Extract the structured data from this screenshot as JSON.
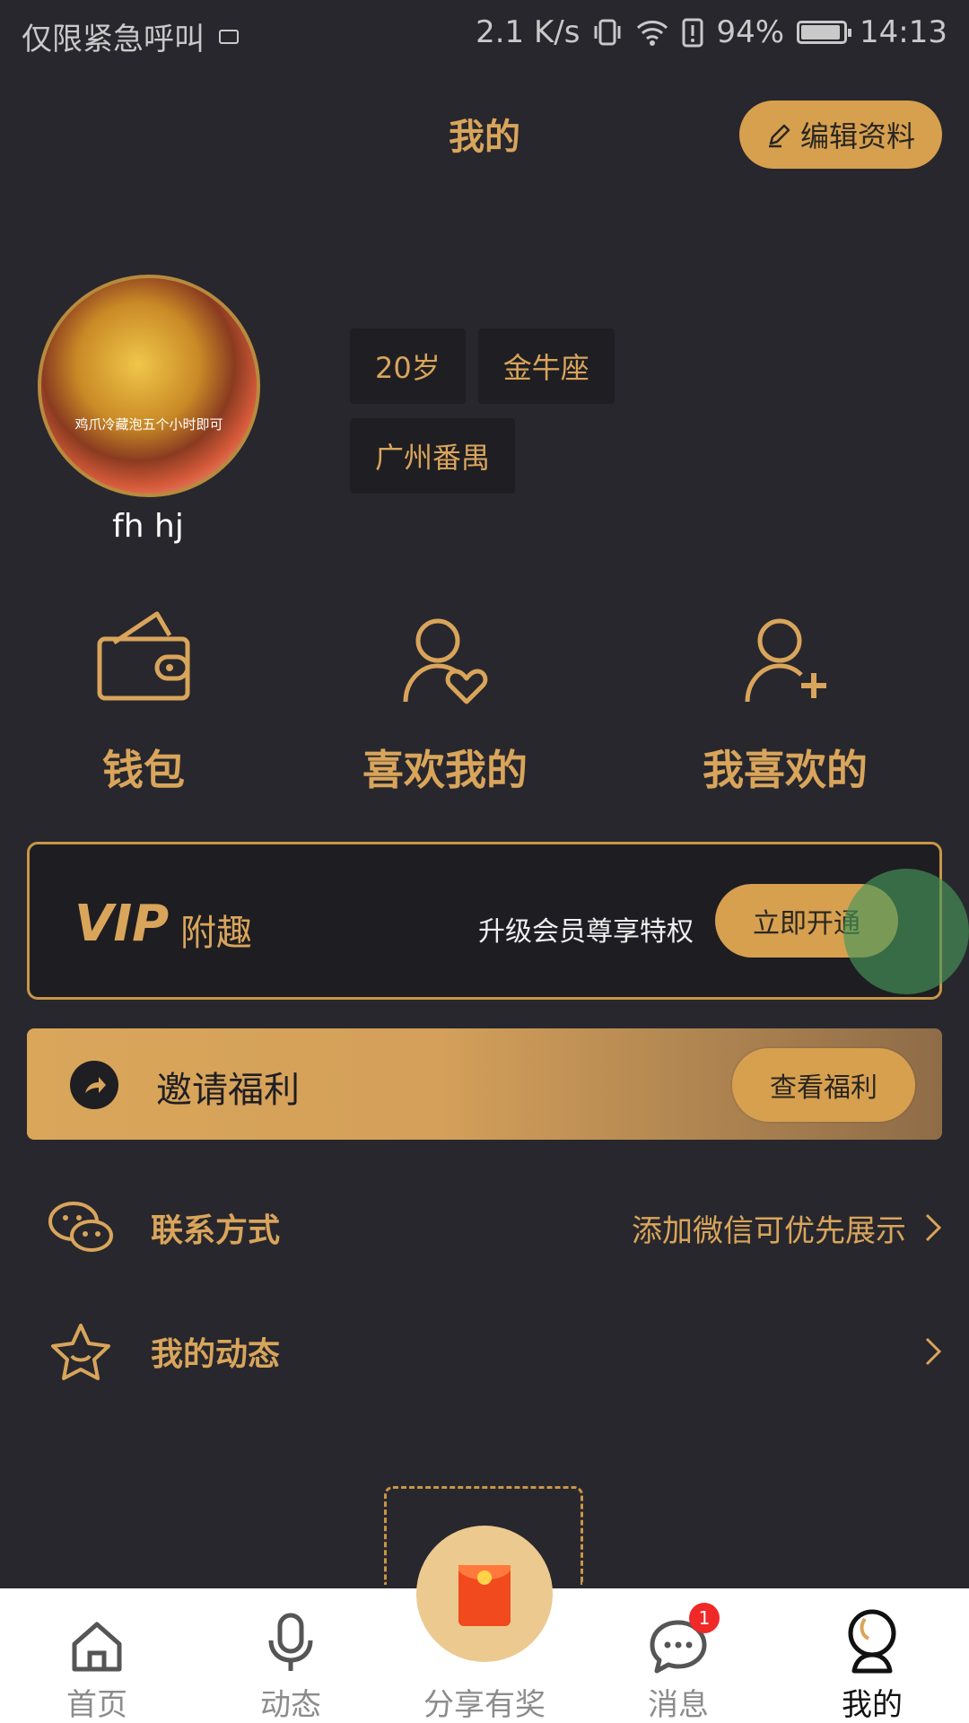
{
  "status_bar": {
    "carrier": "仅限紧急呼叫",
    "speed": "2.1 K/s",
    "battery": "94%",
    "battery_level": 0.94,
    "time": "14:13"
  },
  "header": {
    "title": "我的",
    "edit_button": "编辑资料"
  },
  "profile": {
    "avatar_caption": "鸡爪冷藏泡五个小时即可",
    "nickname": "fh hj",
    "tags": [
      "20岁",
      "金牛座",
      "广州番禺"
    ]
  },
  "quick_actions": [
    {
      "label": "钱包",
      "icon": "wallet-icon"
    },
    {
      "label": "喜欢我的",
      "icon": "user-heart-icon"
    },
    {
      "label": "我喜欢的",
      "icon": "user-plus-icon"
    }
  ],
  "vip": {
    "badge": "VIP",
    "subtitle": "附趣",
    "description": "升级会员尊享特权",
    "button": "立即开通"
  },
  "invite": {
    "label": "邀请福利",
    "button": "查看福利"
  },
  "list": {
    "contact": {
      "label": "联系方式",
      "hint": "添加微信可优先展示",
      "icon": "wechat-icon"
    },
    "posts": {
      "label": "我的动态",
      "hint": "",
      "icon": "star-icon"
    }
  },
  "tabbar": {
    "home": "首页",
    "moments": "动态",
    "share": "分享有奖",
    "messages": "消息",
    "messages_badge": "1",
    "mine": "我的"
  },
  "colors": {
    "background": "#28272d",
    "accent": "#d9a55b",
    "button": "#d6a04f"
  }
}
